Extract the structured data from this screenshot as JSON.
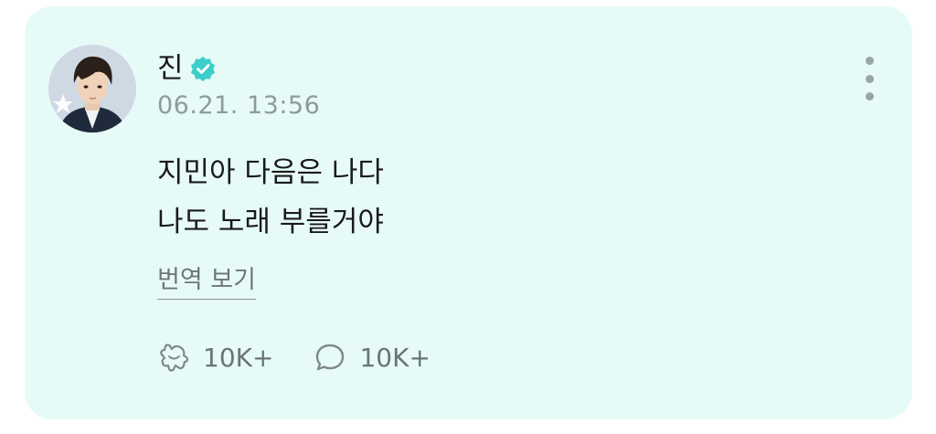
{
  "post": {
    "author": "진",
    "timestamp": "06.21. 13:56",
    "lines": [
      "지민아 다음은 나다",
      "나도 노래 부를거야"
    ],
    "translate_label": "번역 보기",
    "stats": {
      "likes": "10K+",
      "comments": "10K+"
    }
  },
  "icons": {
    "verified": "verified-badge-icon",
    "more": "more-vertical-icon",
    "like": "like-reaction-icon",
    "comment": "comment-bubble-icon",
    "avatar_badge": "star-badge-icon"
  },
  "colors": {
    "card_background": "#e6fbf7",
    "verified": "#3ccfc9",
    "text_primary": "#1a1a1a",
    "text_secondary": "#8e9a9c"
  }
}
